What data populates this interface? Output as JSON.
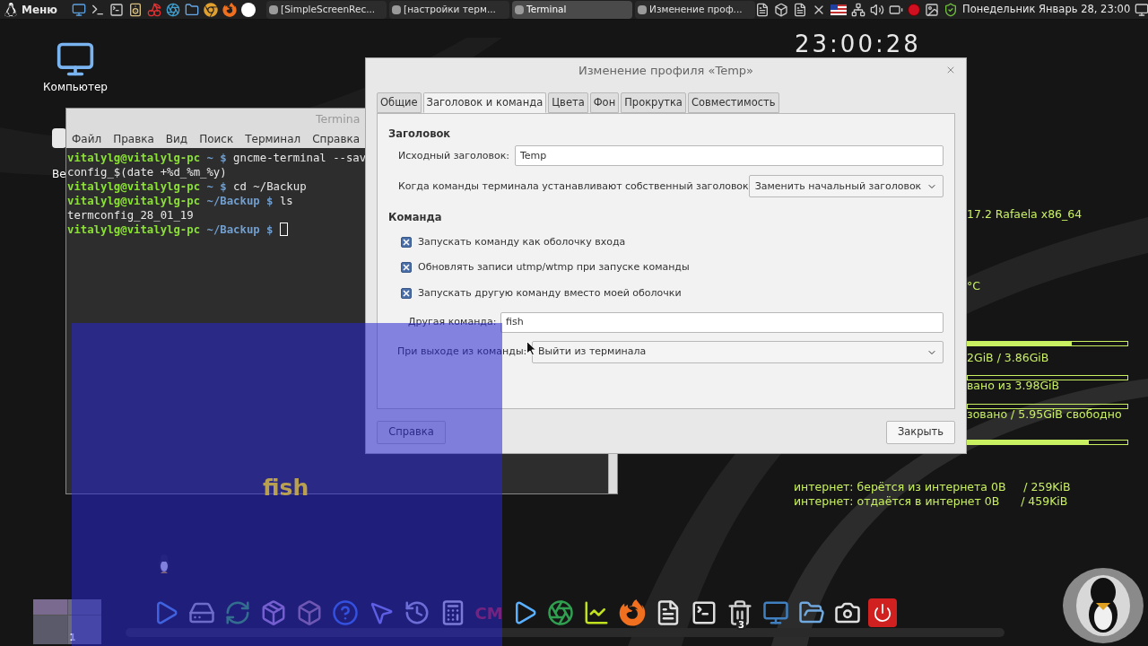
{
  "taskbar": {
    "menu_label": "Меню",
    "tasks": [
      {
        "label": "[SimpleScreenRec...",
        "selected": false
      },
      {
        "label": "[настройки терм...",
        "selected": false
      },
      {
        "label": "Terminal",
        "selected": true
      },
      {
        "label": "Изменение проф...",
        "selected": false
      }
    ],
    "clock": "Понедельник Январь 28, 23:00"
  },
  "desktop_icons": [
    {
      "label": "Компьютер"
    },
    {
      "label": "Ве"
    }
  ],
  "clock_widget": "23:00:28",
  "conky": {
    "lines": [
      {
        "kind": "text",
        "text": "17.2 Rafaela x86_64"
      },
      {
        "kind": "text",
        "text": "°C"
      },
      {
        "kind": "bar",
        "level": 0.65
      },
      {
        "kind": "text",
        "text": "2GiB / 3.86GiB"
      },
      {
        "kind": "track"
      },
      {
        "kind": "text",
        "text": "вано из 3.98GiB"
      },
      {
        "kind": "track"
      },
      {
        "kind": "text",
        "text": "зовано / 5.95GiB свободно"
      },
      {
        "kind": "bar",
        "level": 0.76
      }
    ],
    "network": [
      "интернет: берётся из интернета 0В     / 259KiB",
      "интернет: отдаётся в интернет 0В      / 459KiB"
    ]
  },
  "terminal": {
    "title": "Termina",
    "menu": [
      "Файл",
      "Правка",
      "Вид",
      "Поиск",
      "Терминал",
      "Справка"
    ],
    "lines": [
      [
        {
          "kind": "user",
          "text": "vitalylg@vitalylg-pc"
        },
        {
          "kind": "path",
          "text": " ~ $ "
        },
        {
          "kind": "plain",
          "text": "gncme-terminal --sav"
        }
      ],
      [
        {
          "kind": "plain",
          "text": "config_$(date +%d_%m_%y)"
        }
      ],
      [
        {
          "kind": "user",
          "text": "vitalylg@vitalylg-pc"
        },
        {
          "kind": "path",
          "text": " ~ $ "
        },
        {
          "kind": "plain",
          "text": "cd ~/Backup"
        }
      ],
      [
        {
          "kind": "user",
          "text": "vitalylg@vitalylg-pc"
        },
        {
          "kind": "path",
          "text": " ~/Backup $ "
        },
        {
          "kind": "plain",
          "text": "ls"
        }
      ],
      [
        {
          "kind": "plain",
          "text": "termconfig_28_01_19"
        }
      ],
      [
        {
          "kind": "user",
          "text": "vitalylg@vitalylg-pc"
        },
        {
          "kind": "path",
          "text": " ~/Backup $ "
        },
        {
          "kind": "cursor"
        }
      ]
    ]
  },
  "dialog": {
    "title": "Изменение профиля «Temp»",
    "tabs": [
      {
        "label": "Общие",
        "selected": false
      },
      {
        "label": "Заголовок и команда",
        "selected": true
      },
      {
        "label": "Цвета",
        "selected": false
      },
      {
        "label": "Фон",
        "selected": false
      },
      {
        "label": "Прокрутка",
        "selected": false
      },
      {
        "label": "Совместимость",
        "selected": false
      }
    ],
    "title_section": {
      "heading": "Заголовок",
      "initial_title_label": "Исходный заголовок:",
      "initial_title_value": "Temp",
      "when_label": "Когда команды терминала устанавливают собственный заголовок",
      "when_value": "Заменить начальный заголовок"
    },
    "command_section": {
      "heading": "Команда",
      "checkboxes": [
        {
          "label": "Запускать команду как оболочку входа",
          "checked": true
        },
        {
          "label": "Обновлять записи utmp/wtmp при запуске команды",
          "checked": true
        },
        {
          "label": "Запускать другую команду вместо моей оболочки",
          "checked": true
        }
      ],
      "custom_command_label": "Другая команда:",
      "custom_command_value": "fish",
      "on_exit_label": "При выходе из команды:",
      "on_exit_value": "Выйти из терминала"
    },
    "buttons": {
      "help": "Справка",
      "close": "Закрыть"
    }
  },
  "overlay": {
    "text": "fish"
  },
  "dock": {
    "workspace": "1",
    "cm_label": "CM",
    "trash_count": "3"
  }
}
